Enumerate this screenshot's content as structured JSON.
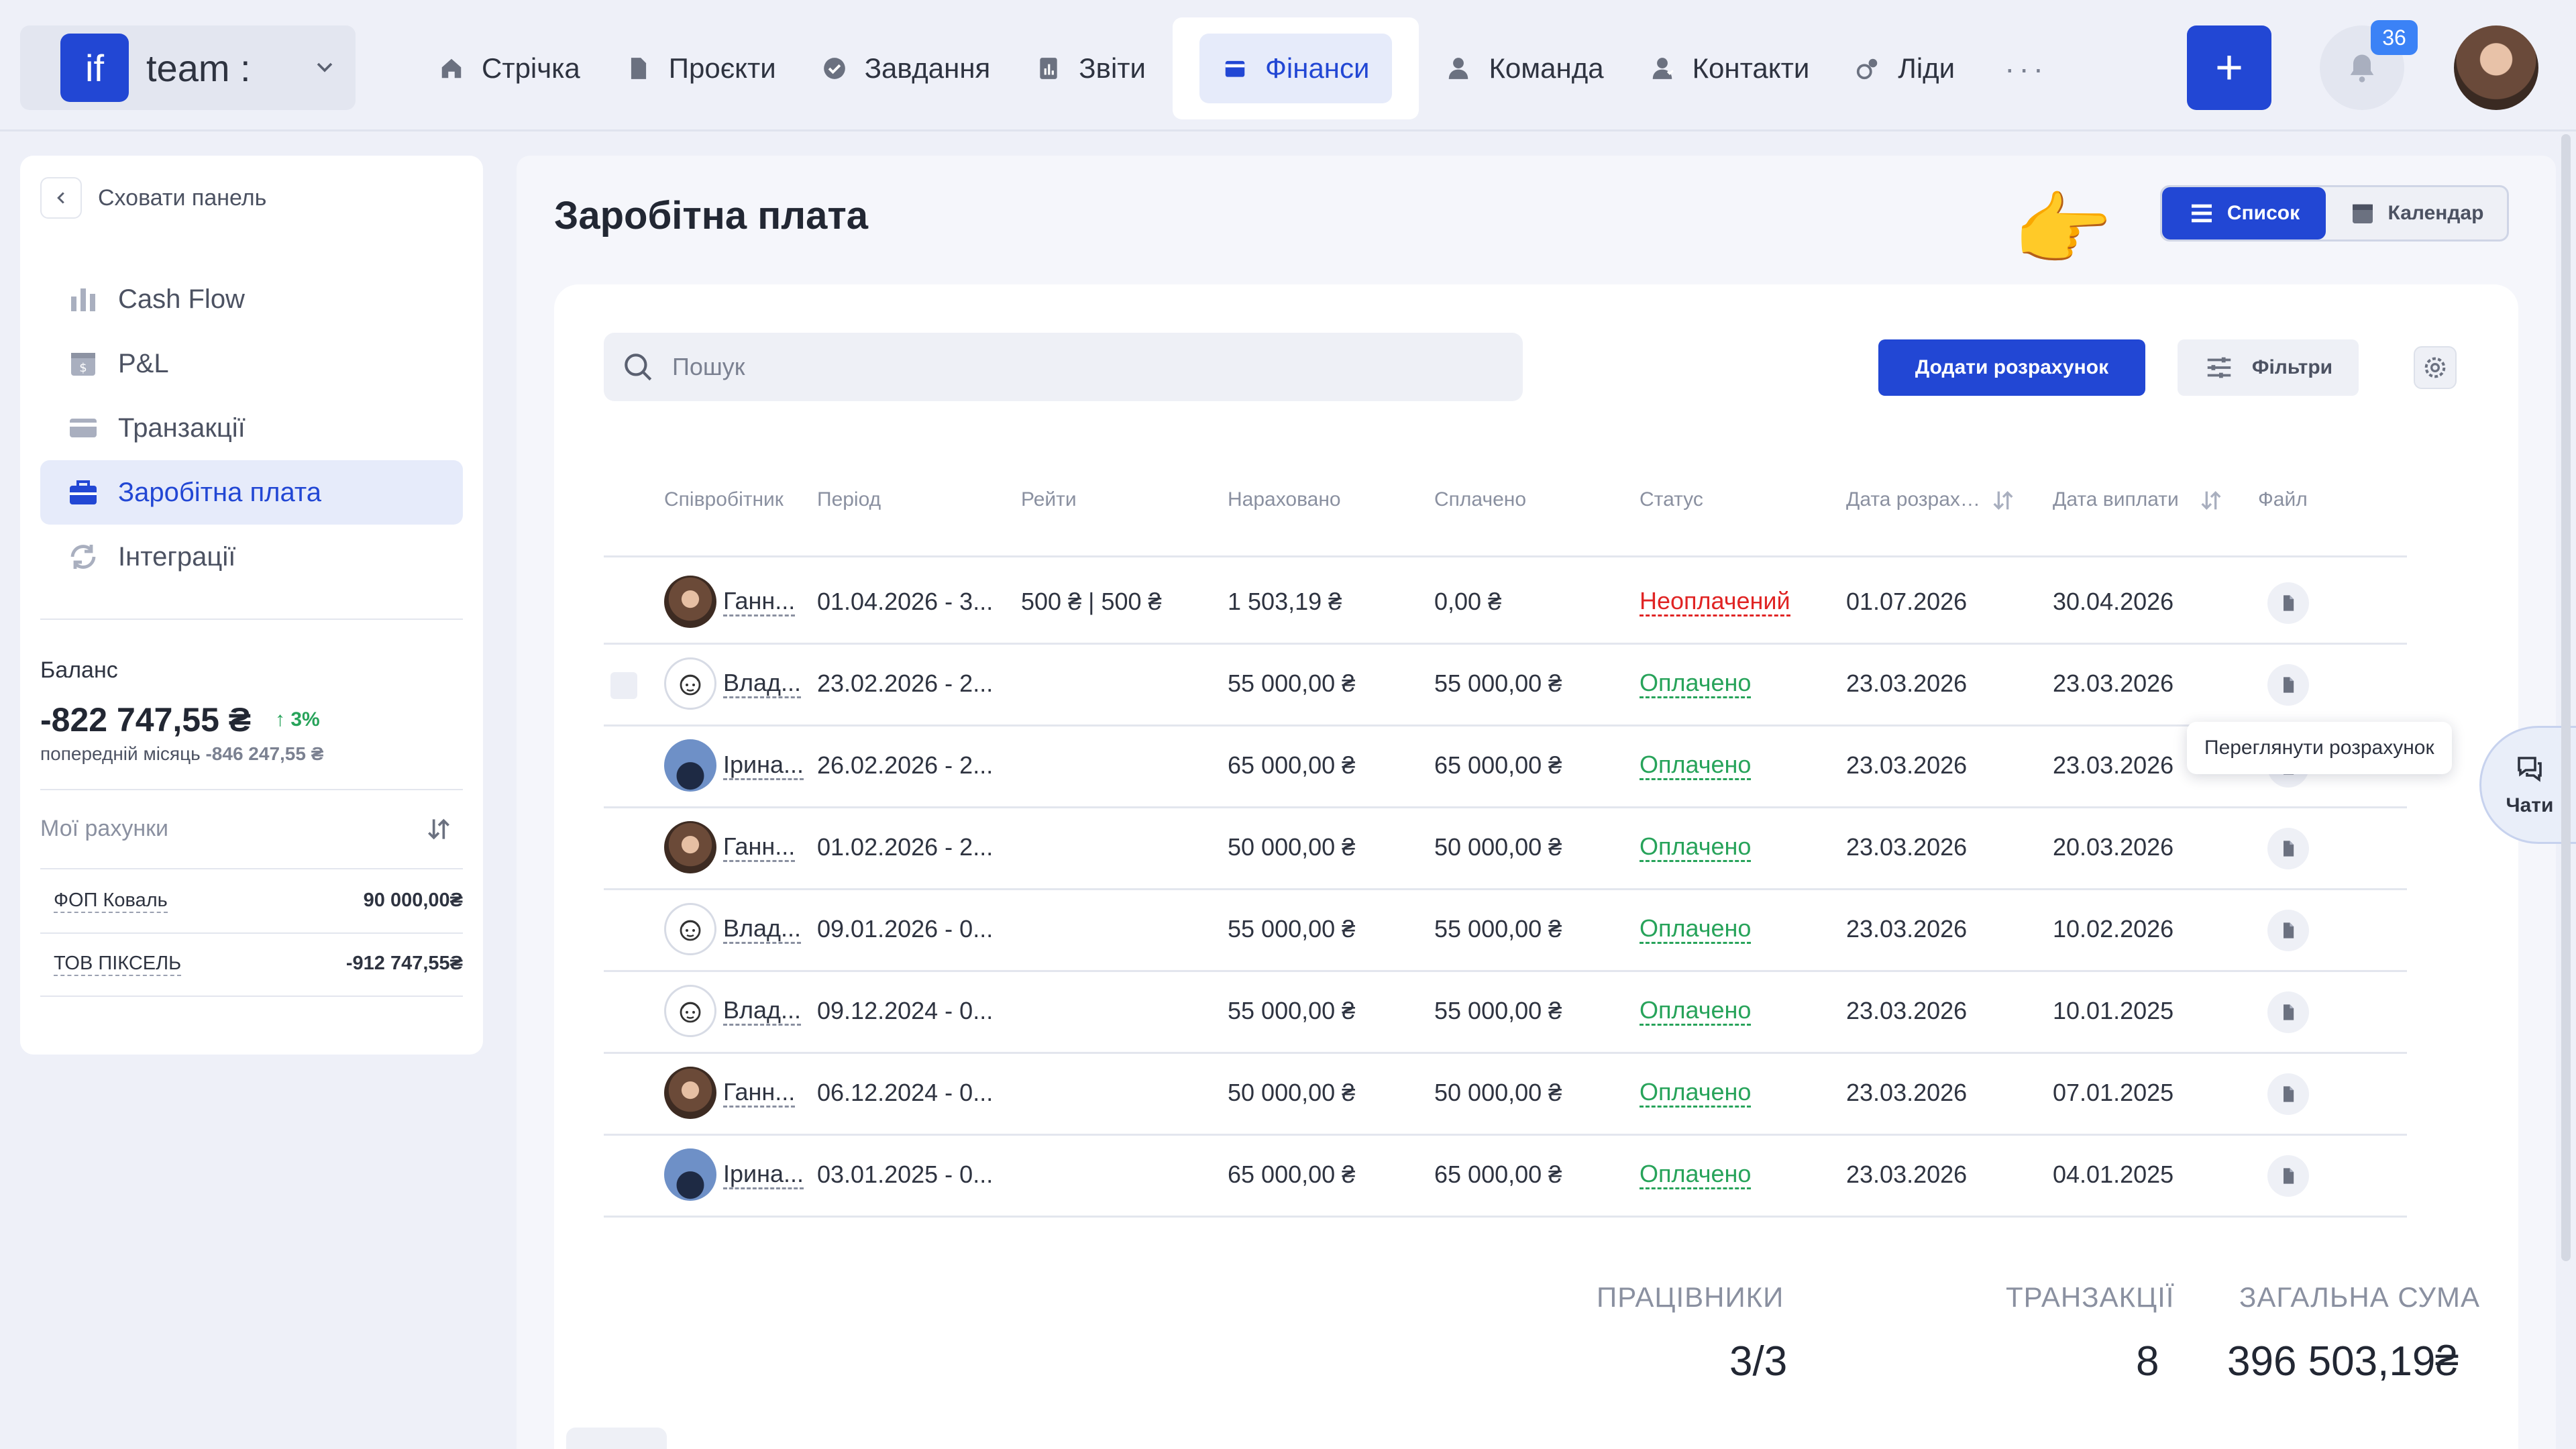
{
  "app": {
    "logo_text": "if",
    "team_name": "team :",
    "notifications_count": "36",
    "plus_label": "+"
  },
  "nav": {
    "items": [
      {
        "label": "Стрічка",
        "icon": "home-icon"
      },
      {
        "label": "Проєкти",
        "icon": "document-icon"
      },
      {
        "label": "Завдання",
        "icon": "check-circle-icon"
      },
      {
        "label": "Звіти",
        "icon": "report-icon"
      },
      {
        "label": "Фінанси",
        "icon": "wallet-icon",
        "active": true
      },
      {
        "label": "Команда",
        "icon": "person-icon"
      },
      {
        "label": "Контакти",
        "icon": "contacts-icon"
      },
      {
        "label": "Ліди",
        "icon": "leads-icon"
      }
    ],
    "more": "···"
  },
  "sidebar": {
    "hide_label": "Сховати панель",
    "items": [
      {
        "label": "Cash Flow",
        "icon": "chart-bars-icon"
      },
      {
        "label": "P&L",
        "icon": "calendar-dollar-icon"
      },
      {
        "label": "Транзакції",
        "icon": "card-icon"
      },
      {
        "label": "Заробітна плата",
        "icon": "briefcase-icon",
        "active": true
      },
      {
        "label": "Інтеграції",
        "icon": "sync-icon"
      }
    ],
    "balance": {
      "label": "Баланс",
      "value": "-822 747,55 ₴",
      "change": "↑ 3%",
      "prev_label": "попередній місяць",
      "prev_value": "-846 247,55 ₴"
    },
    "accounts_label": "Мої рахунки",
    "accounts": [
      {
        "name": "ФОП Коваль",
        "value": "90 000,00₴"
      },
      {
        "name": "ТОВ ПІКСЕЛЬ",
        "value": "-912 747,55₴"
      }
    ]
  },
  "page": {
    "title": "Заробітна плата",
    "hand": "👉",
    "view_list": "Список",
    "view_calendar": "Календар",
    "search_placeholder": "Пошук",
    "add_button": "Додати розрахунок",
    "filters_button": "Фільтри",
    "tooltip": "Переглянути розрахунок",
    "chats": "Чати"
  },
  "table": {
    "columns": {
      "employee": "Співробітник",
      "period": "Період",
      "rates": "Рейти",
      "accrued": "Нараховано",
      "paid": "Сплачено",
      "status": "Статус",
      "calc_date": "Дата розрахунку",
      "pay_date": "Дата виплати",
      "file": "Файл"
    },
    "rows": [
      {
        "name": "Ганн...",
        "avatar": "woman",
        "period": "01.04.2026 - 3...",
        "rates": "500 ₴ | 500 ₴",
        "accrued": "1 503,19 ₴",
        "paid": "0,00 ₴",
        "status": "Неоплачений",
        "status_type": "unpaid",
        "calc_date": "01.07.2026",
        "pay_date": "30.04.2026"
      },
      {
        "name": "Влад...",
        "avatar": "drawing",
        "period": "23.02.2026 - 2...",
        "rates": "",
        "accrued": "55 000,00 ₴",
        "paid": "55 000,00 ₴",
        "status": "Оплачено",
        "status_type": "paid",
        "calc_date": "23.03.2026",
        "pay_date": "23.03.2026"
      },
      {
        "name": "Ірина...",
        "avatar": "man",
        "period": "26.02.2026 - 2...",
        "rates": "",
        "accrued": "65 000,00 ₴",
        "paid": "65 000,00 ₴",
        "status": "Оплачено",
        "status_type": "paid",
        "calc_date": "23.03.2026",
        "pay_date": "23.03.2026"
      },
      {
        "name": "Ганн...",
        "avatar": "woman",
        "period": "01.02.2026 - 2...",
        "rates": "",
        "accrued": "50 000,00 ₴",
        "paid": "50 000,00 ₴",
        "status": "Оплачено",
        "status_type": "paid",
        "calc_date": "23.03.2026",
        "pay_date": "20.03.2026"
      },
      {
        "name": "Влад...",
        "avatar": "drawing",
        "period": "09.01.2026 - 0...",
        "rates": "",
        "accrued": "55 000,00 ₴",
        "paid": "55 000,00 ₴",
        "status": "Оплачено",
        "status_type": "paid",
        "calc_date": "23.03.2026",
        "pay_date": "10.02.2026"
      },
      {
        "name": "Влад...",
        "avatar": "drawing",
        "period": "09.12.2024 - 0...",
        "rates": "",
        "accrued": "55 000,00 ₴",
        "paid": "55 000,00 ₴",
        "status": "Оплачено",
        "status_type": "paid",
        "calc_date": "23.03.2026",
        "pay_date": "10.01.2025"
      },
      {
        "name": "Ганн...",
        "avatar": "woman",
        "period": "06.12.2024 - 0...",
        "rates": "",
        "accrued": "50 000,00 ₴",
        "paid": "50 000,00 ₴",
        "status": "Оплачено",
        "status_type": "paid",
        "calc_date": "23.03.2026",
        "pay_date": "07.01.2025"
      },
      {
        "name": "Ірина...",
        "avatar": "man",
        "period": "03.01.2025 - 0...",
        "rates": "",
        "accrued": "65 000,00 ₴",
        "paid": "65 000,00 ₴",
        "status": "Оплачено",
        "status_type": "paid",
        "calc_date": "23.03.2026",
        "pay_date": "04.01.2025"
      }
    ]
  },
  "summary": {
    "employees_label": "ПРАЦІВНИКИ",
    "employees_value": "3/3",
    "transactions_label": "ТРАНЗАКЦІЇ",
    "transactions_value": "8",
    "total_label": "ЗАГАЛЬНА СУМА",
    "total_value": "396 503,19₴"
  },
  "colors": {
    "accent": "#2247d4",
    "paid": "#27a35a",
    "unpaid": "#e02424"
  }
}
